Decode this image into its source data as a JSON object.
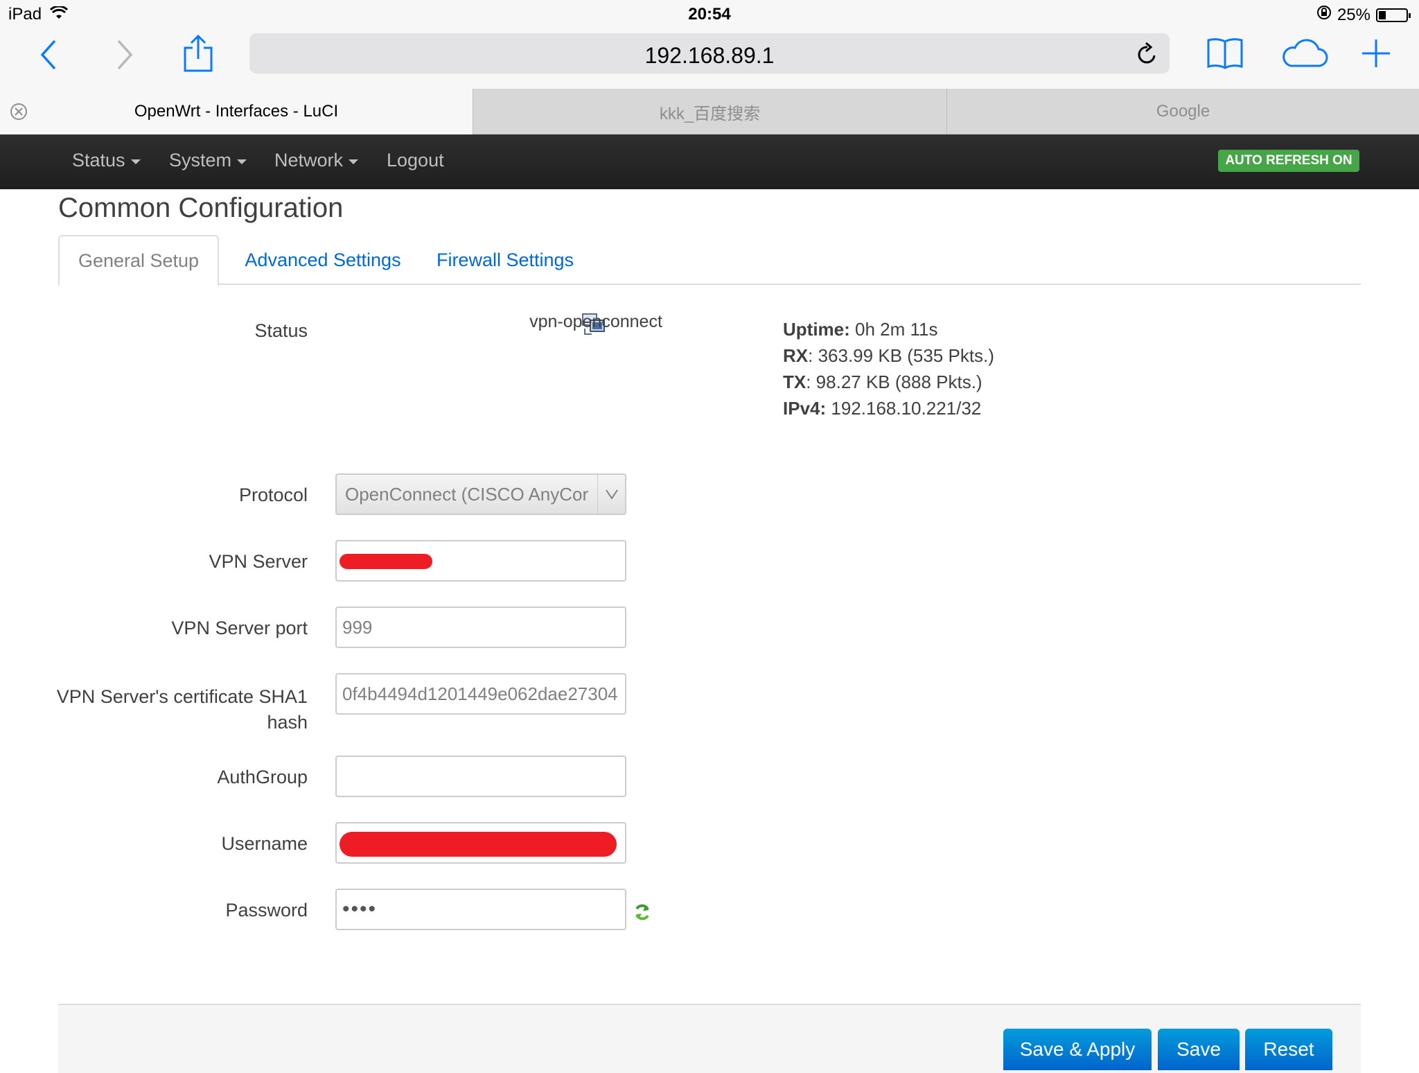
{
  "status_bar": {
    "device": "iPad",
    "time": "20:54",
    "battery": "25%",
    "battery_level": 0.25
  },
  "browser": {
    "url": "192.168.89.1",
    "tabs": [
      {
        "title": "OpenWrt - Interfaces - LuCI",
        "active": true
      },
      {
        "title": "kkk_百度搜索",
        "active": false
      },
      {
        "title": "Google",
        "active": false
      }
    ]
  },
  "nav": {
    "items": [
      {
        "label": "Status",
        "dropdown": true
      },
      {
        "label": "System",
        "dropdown": true
      },
      {
        "label": "Network",
        "dropdown": true
      },
      {
        "label": "Logout",
        "dropdown": false
      }
    ],
    "auto_refresh": "AUTO REFRESH ON"
  },
  "page": {
    "title": "Common Configuration",
    "tabs": [
      "General Setup",
      "Advanced Settings",
      "Firewall Settings"
    ],
    "status": {
      "label": "Status",
      "device": "vpn-openconnect",
      "uptime_key": "Uptime:",
      "uptime": " 0h 2m 11s",
      "rx_key": "RX",
      "rx": ": 363.99 KB (535 Pkts.)",
      "tx_key": "TX",
      "tx": ": 98.27 KB (888 Pkts.)",
      "ipv4_key": "IPv4:",
      "ipv4": " 192.168.10.221/32"
    },
    "form": {
      "protocol_label": "Protocol",
      "protocol_value": "OpenConnect (CISCO AnyCor",
      "server_label": "VPN Server",
      "port_label": "VPN Server port",
      "port_value": "999",
      "cert_label_1": "VPN Server's certificate SHA1",
      "cert_label_2": "hash",
      "cert_value": "0f4b4494d1201449e062dae27304",
      "authgroup_label": "AuthGroup",
      "authgroup_value": "",
      "username_label": "Username",
      "password_label": "Password",
      "password_value": "••••"
    },
    "buttons": {
      "save_apply": "Save & Apply",
      "save": "Save",
      "reset": "Reset"
    }
  },
  "colors": {
    "accent": "#0069d6",
    "nav_bg": "#262626",
    "badge": "#46a546",
    "redaction": "#ee1c25"
  }
}
